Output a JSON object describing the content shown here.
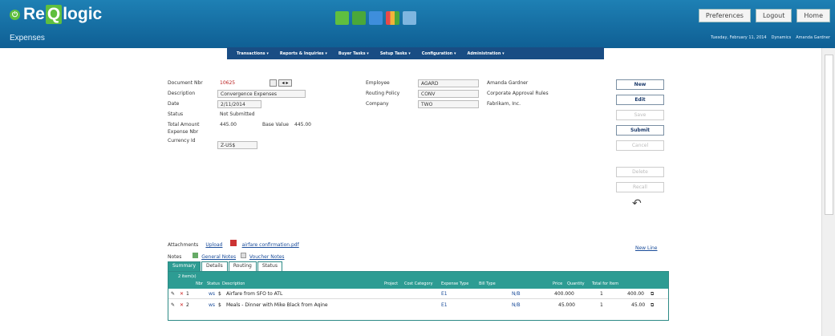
{
  "app": {
    "logo_prefix": "Re",
    "logo_q": "Q",
    "logo_suffix": "logic",
    "module": "Expenses"
  },
  "top_buttons": [
    "Preferences",
    "Logout",
    "Home"
  ],
  "date_info": [
    "Tuesday, February 11, 2014",
    "Dynamics",
    "Amanda Gardner"
  ],
  "menu": [
    "Transactions ▾",
    "Reports & Inquiries ▾",
    "Buyer Tasks ▾",
    "Setup Tasks ▾",
    "Configuration ▾",
    "Administration ▾"
  ],
  "form": {
    "doc_label": "Document Nbr",
    "doc_value": "10625",
    "desc_label": "Description",
    "desc_value": "Convergence Expenses",
    "date_label": "Date",
    "date_value": "2/11/2014",
    "status_label": "Status",
    "status_value": "Not Submitted",
    "total_label": "Total Amount",
    "total_value": "445.00",
    "base_label": "Base Value",
    "base_value": "445.00",
    "expnbr_label": "Expense Nbr",
    "currency_label": "Currency Id",
    "currency_value": "Z-US$",
    "employee_label": "Employee",
    "employee_value": "AGARD",
    "employee_name": "Amanda Gardner",
    "routing_label": "Routing Policy",
    "routing_value": "CONV",
    "routing_name": "Corporate Approval Rules",
    "company_label": "Company",
    "company_value": "TWO",
    "company_name": "Fabrikam, Inc."
  },
  "right_buttons": [
    {
      "label": "New",
      "enabled": true
    },
    {
      "label": "Edit",
      "enabled": true
    },
    {
      "label": "Save",
      "enabled": false
    },
    {
      "label": "Submit",
      "enabled": true
    },
    {
      "label": "Cancel",
      "enabled": false
    },
    {
      "label": "Delete",
      "enabled": false
    },
    {
      "label": "Recall",
      "enabled": false
    }
  ],
  "attachments": {
    "label": "Attachments",
    "upload": "Upload",
    "file": "airfare confirmation.pdf",
    "notes_label": "Notes",
    "general_notes": "General Notes",
    "voucher_notes": "Voucher Notes"
  },
  "new_line": "New Line",
  "tabs": [
    "Summary",
    "Details",
    "Routing",
    "Status"
  ],
  "grid": {
    "item_count": "2 item(s)",
    "columns": [
      "Nbr",
      "Status",
      "Description",
      "Project",
      "Cost Category",
      "Expense Type",
      "Bill Type",
      "Price",
      "Quantity",
      "Total for Item"
    ],
    "rows": [
      {
        "nbr": "1",
        "status": "ws",
        "description": "Airfare from SFO to ATL",
        "expense_type": "E1",
        "bill_type": "N/B",
        "price": "400.000",
        "qty": "1",
        "total": "400.00"
      },
      {
        "nbr": "2",
        "status": "ws",
        "description": "Meals - Dinner with Mike Black from Aqine",
        "expense_type": "E1",
        "bill_type": "N/B",
        "price": "45.000",
        "qty": "1",
        "total": "45.00"
      }
    ]
  },
  "colors": {
    "header": "#1e80b4",
    "menu": "#194d84",
    "grid_header": "#2d9c93",
    "accent_green": "#5fbf3f"
  }
}
